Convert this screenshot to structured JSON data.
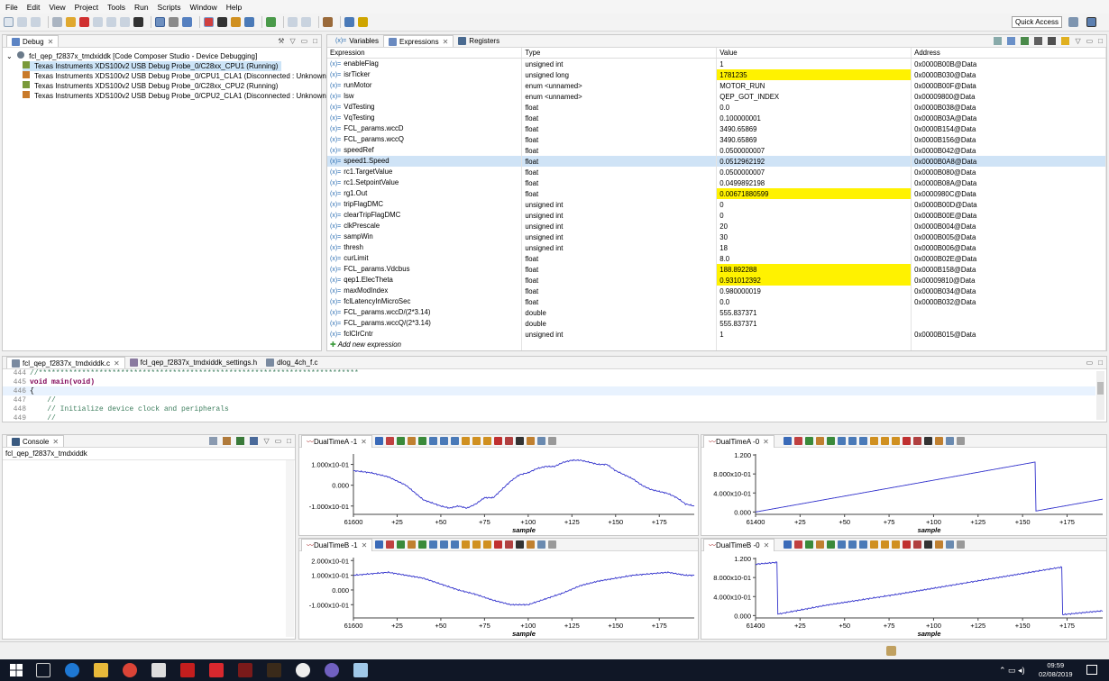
{
  "menu": [
    "File",
    "Edit",
    "View",
    "Project",
    "Tools",
    "Run",
    "Scripts",
    "Window",
    "Help"
  ],
  "quick_access": "Quick Access",
  "debug_view": {
    "tab_label": "Debug",
    "root": "fcl_qep_f2837x_tmdxiddk [Code Composer Studio - Device Debugging]",
    "items": [
      "Texas Instruments XDS100v2 USB Debug Probe_0/C28xx_CPU1 (Running)",
      "Texas Instruments XDS100v2 USB Debug Probe_0/CPU1_CLA1 (Disconnected : Unknown)",
      "Texas Instruments XDS100v2 USB Debug Probe_0/C28xx_CPU2 (Running)",
      "Texas Instruments XDS100v2 USB Debug Probe_0/CPU2_CLA1 (Disconnected : Unknown)"
    ]
  },
  "expressions_view": {
    "tabs": [
      "Variables",
      "Expressions",
      "Registers"
    ],
    "columns": [
      "Expression",
      "Type",
      "Value",
      "Address"
    ],
    "rows": [
      [
        "enableFlag",
        "unsigned int",
        "1",
        "0x0000B00B@Data"
      ],
      [
        "isrTicker",
        "unsigned long",
        "1781235",
        "0x0000B030@Data"
      ],
      [
        "runMotor",
        "enum <unnamed>",
        "MOTOR_RUN",
        "0x0000B00F@Data"
      ],
      [
        "lsw",
        "enum <unnamed>",
        "QEP_GOT_INDEX",
        "0x00009800@Data"
      ],
      [
        "VdTesting",
        "float",
        "0.0",
        "0x0000B038@Data"
      ],
      [
        "VqTesting",
        "float",
        "0.100000001",
        "0x0000B03A@Data"
      ],
      [
        "FCL_params.wccD",
        "float",
        "3490.65869",
        "0x0000B154@Data"
      ],
      [
        "FCL_params.wccQ",
        "float",
        "3490.65869",
        "0x0000B156@Data"
      ],
      [
        "speedRef",
        "float",
        "0.0500000007",
        "0x0000B042@Data"
      ],
      [
        "speed1.Speed",
        "float",
        "0.0512962192",
        "0x0000B0A8@Data"
      ],
      [
        "rc1.TargetValue",
        "float",
        "0.0500000007",
        "0x0000B080@Data"
      ],
      [
        "rc1.SetpointValue",
        "float",
        "0.0499892198",
        "0x0000B08A@Data"
      ],
      [
        "rg1.Out",
        "float",
        "0.00671880599",
        "0x0000980C@Data"
      ],
      [
        "tripFlagDMC",
        "unsigned int",
        "0",
        "0x0000B00D@Data"
      ],
      [
        "clearTripFlagDMC",
        "unsigned int",
        "0",
        "0x0000B00E@Data"
      ],
      [
        "clkPrescale",
        "unsigned int",
        "20",
        "0x0000B004@Data"
      ],
      [
        "sampWin",
        "unsigned int",
        "30",
        "0x0000B005@Data"
      ],
      [
        "thresh",
        "unsigned int",
        "18",
        "0x0000B006@Data"
      ],
      [
        "curLimit",
        "float",
        "8.0",
        "0x0000B02E@Data"
      ],
      [
        "FCL_params.Vdcbus",
        "float",
        "188.892288",
        "0x0000B158@Data"
      ],
      [
        "qep1.ElecTheta",
        "float",
        "0.931012392",
        "0x00009810@Data"
      ],
      [
        "maxModIndex",
        "float",
        "0.980000019",
        "0x0000B034@Data"
      ],
      [
        "fclLatencyInMicroSec",
        "float",
        "0.0",
        "0x0000B032@Data"
      ],
      [
        "FCL_params.wccD/(2*3.14)",
        "double",
        "555.837371",
        ""
      ],
      [
        "FCL_params.wccQ/(2*3.14)",
        "double",
        "555.837371",
        ""
      ],
      [
        "fclClrCntr",
        "unsigned int",
        "1",
        "0x0000B015@Data"
      ]
    ],
    "highlighted_rows": [
      1,
      12,
      19,
      20
    ],
    "selected_row": 9,
    "add_new": "Add new expression"
  },
  "editor": {
    "tabs": [
      "fcl_qep_f2837x_tmdxiddk.c",
      "fcl_qep_f2837x_tmdxiddk_settings.h",
      "dlog_4ch_f.c"
    ],
    "lines": [
      {
        "num": "444",
        "text": "//**************************************************************************"
      },
      {
        "num": "445",
        "text": "void main(void)"
      },
      {
        "num": "446",
        "text": "{"
      },
      {
        "num": "447",
        "text": "    //"
      },
      {
        "num": "448",
        "text": "    // Initialize device clock and peripherals"
      },
      {
        "num": "449",
        "text": "    //"
      }
    ]
  },
  "console": {
    "tab_label": "Console",
    "text": "fcl_qep_f2837x_tmdxiddk"
  },
  "colors": {
    "highlight": "#fff200",
    "selection": "#cfe3f6",
    "plot_line": "#3333cc"
  },
  "chart_data": [
    {
      "type": "line",
      "title": "DualTimeA -1",
      "xlabel": "sample",
      "x_start": 61600,
      "xticks": [
        "61600",
        "+25",
        "+50",
        "+75",
        "+100",
        "+125",
        "+150",
        "+175"
      ],
      "yticks": [
        {
          "label": "1.000x10-01",
          "v": 0.1
        },
        {
          "label": "0.000",
          "v": 0.0
        },
        {
          "label": "-1.000x10-01",
          "v": -0.1
        }
      ],
      "ylim": [
        -0.14,
        0.15
      ],
      "x": [
        0,
        10,
        20,
        30,
        40,
        50,
        55,
        60,
        65,
        70,
        75,
        80,
        85,
        90,
        95,
        100,
        105,
        110,
        115,
        120,
        125,
        130,
        135,
        140,
        145,
        150,
        155,
        160,
        165,
        170,
        175,
        180,
        185,
        190,
        195
      ],
      "values": [
        0.07,
        0.06,
        0.04,
        0.0,
        -0.07,
        -0.1,
        -0.11,
        -0.1,
        -0.11,
        -0.09,
        -0.06,
        -0.06,
        -0.02,
        0.02,
        0.05,
        0.06,
        0.08,
        0.09,
        0.09,
        0.11,
        0.12,
        0.12,
        0.11,
        0.1,
        0.1,
        0.07,
        0.05,
        0.03,
        0.0,
        -0.02,
        -0.03,
        -0.04,
        -0.06,
        -0.09,
        -0.1
      ]
    },
    {
      "type": "line",
      "title": "DualTimeA -0",
      "xlabel": "sample",
      "x_start": 61400,
      "xticks": [
        "61400",
        "+25",
        "+50",
        "+75",
        "+100",
        "+125",
        "+150",
        "+175"
      ],
      "yticks": [
        {
          "label": "1.200",
          "v": 1.2
        },
        {
          "label": "8.000x10-01",
          "v": 0.8
        },
        {
          "label": "4.000x10-01",
          "v": 0.4
        },
        {
          "label": "0.000",
          "v": 0.0
        }
      ],
      "ylim": [
        -0.05,
        1.22
      ],
      "x": [
        0,
        157,
        157.5,
        195
      ],
      "values": [
        0.0,
        1.05,
        0.02,
        0.27
      ]
    },
    {
      "type": "line",
      "title": "DualTimeB -1",
      "xlabel": "sample",
      "x_start": 61600,
      "xticks": [
        "61600",
        "+25",
        "+50",
        "+75",
        "+100",
        "+125",
        "+150",
        "+175"
      ],
      "yticks": [
        {
          "label": "2.000x10-01",
          "v": 0.2
        },
        {
          "label": "1.000x10-01",
          "v": 0.1
        },
        {
          "label": "0.000",
          "v": 0.0
        },
        {
          "label": "-1.000x10-01",
          "v": -0.1
        }
      ],
      "ylim": [
        -0.19,
        0.22
      ],
      "x": [
        0,
        10,
        20,
        30,
        40,
        50,
        60,
        70,
        80,
        90,
        100,
        110,
        120,
        130,
        140,
        150,
        160,
        170,
        180,
        190,
        195
      ],
      "values": [
        0.1,
        0.11,
        0.12,
        0.1,
        0.08,
        0.04,
        0.0,
        -0.03,
        -0.07,
        -0.1,
        -0.1,
        -0.06,
        -0.02,
        0.03,
        0.06,
        0.08,
        0.1,
        0.11,
        0.12,
        0.1,
        0.1
      ]
    },
    {
      "type": "line",
      "title": "DualTimeB -0",
      "xlabel": "sample",
      "x_start": 61400,
      "xticks": [
        "61400",
        "+25",
        "+50",
        "+75",
        "+100",
        "+125",
        "+150",
        "+175"
      ],
      "yticks": [
        {
          "label": "1.200",
          "v": 1.2
        },
        {
          "label": "8.000x10-01",
          "v": 0.8
        },
        {
          "label": "4.000x10-01",
          "v": 0.4
        },
        {
          "label": "0.000",
          "v": 0.0
        }
      ],
      "ylim": [
        -0.05,
        1.22
      ],
      "x": [
        0,
        12,
        12.5,
        40,
        80,
        120,
        172,
        172.5,
        195
      ],
      "values": [
        1.08,
        1.12,
        0.03,
        0.22,
        0.45,
        0.7,
        1.02,
        0.02,
        0.1
      ]
    }
  ],
  "taskbar": {
    "time": "09:59",
    "date": "02/08/2019"
  }
}
